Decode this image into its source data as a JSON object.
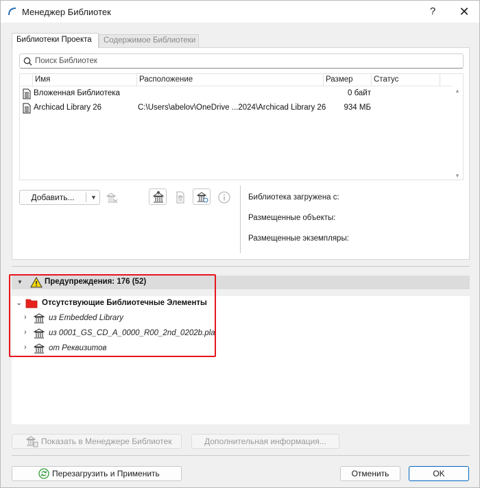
{
  "window": {
    "title": "Менеджер Библиотек",
    "help": "?",
    "close": "✕"
  },
  "tabs": [
    {
      "label": "Библиотеки Проекта",
      "active": true
    },
    {
      "label": "Содержимое Библиотеки",
      "active": false
    }
  ],
  "search": {
    "placeholder": "Поиск Библиотек",
    "value": ""
  },
  "table": {
    "columns": [
      "Имя",
      "Расположение",
      "Размер",
      "Статус"
    ],
    "rows": [
      {
        "name": "Вложенная Библиотека",
        "location": "",
        "size": "0 байт",
        "status": "",
        "icon": "embedded-library-icon"
      },
      {
        "name": "Archicad Library 26",
        "location": "C:\\Users\\abelov\\OneDrive ...2024\\Archicad Library 26",
        "size": "934 МБ",
        "status": "",
        "icon": "library-file-icon"
      }
    ]
  },
  "toolbar": {
    "add_label": "Добавить...",
    "dropdown_arrow": "▼"
  },
  "info": {
    "loaded_from": "Библиотека загружена с:",
    "placed_objects": "Размещенные объекты:",
    "placed_instances": "Размещенные экземпляры:"
  },
  "warnings": {
    "header": "Предупреждения: 176 (52)",
    "group_label": "Отсутствующие Библиотечные Элементы",
    "items": [
      {
        "label": "из Embedded Library"
      },
      {
        "label": "из 0001_GS_CD_A_0000_R00_2nd_0202b.pla"
      },
      {
        "label": "от Реквизитов"
      }
    ]
  },
  "bottom": {
    "show_in_manager": "Показать в Менеджере Библиотек",
    "more_info": "Дополнительная информация...",
    "reload_apply": "Перезагрузить и Применить",
    "cancel": "Отменить",
    "ok": "OK"
  },
  "colors": {
    "accent": "#0067c0",
    "warning_outline": "#e8141c",
    "folder_red": "#e8231c",
    "warning_yellow": "#f5d90a"
  }
}
